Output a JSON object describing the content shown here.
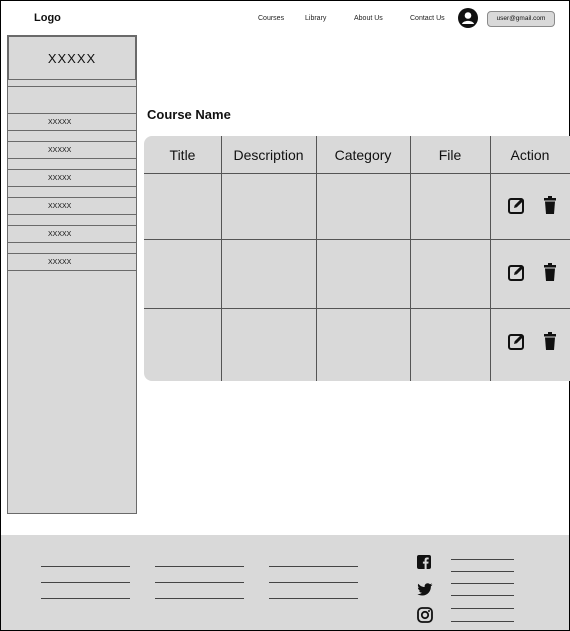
{
  "header": {
    "logo": "Logo",
    "nav": [
      "Courses",
      "Library",
      "About Us",
      "Contact Us"
    ],
    "email": "user@gmail.com"
  },
  "sidebar": {
    "top_label": "XXXXX",
    "items": [
      {
        "label": "XXXXX"
      },
      {
        "label": "XXXXX"
      },
      {
        "label": "XXXXX"
      },
      {
        "label": "XXXXX"
      },
      {
        "label": "XXXXX"
      },
      {
        "label": "XXXXX"
      }
    ]
  },
  "main": {
    "course_name": "Course Name",
    "table": {
      "headers": [
        "Title",
        "Description",
        "Category",
        "File",
        "Action"
      ],
      "rows": [
        {
          "title": "",
          "description": "",
          "category": "",
          "file": ""
        },
        {
          "title": "",
          "description": "",
          "category": "",
          "file": ""
        },
        {
          "title": "",
          "description": "",
          "category": "",
          "file": ""
        }
      ]
    }
  },
  "icons": {
    "avatar": "user-avatar-icon",
    "edit": "edit-icon",
    "delete": "trash-icon",
    "facebook": "facebook-icon",
    "twitter": "twitter-icon",
    "instagram": "instagram-icon"
  },
  "colors": {
    "panel": "#d9d9d9",
    "border": "#6a6a6a",
    "text": "#111111"
  }
}
